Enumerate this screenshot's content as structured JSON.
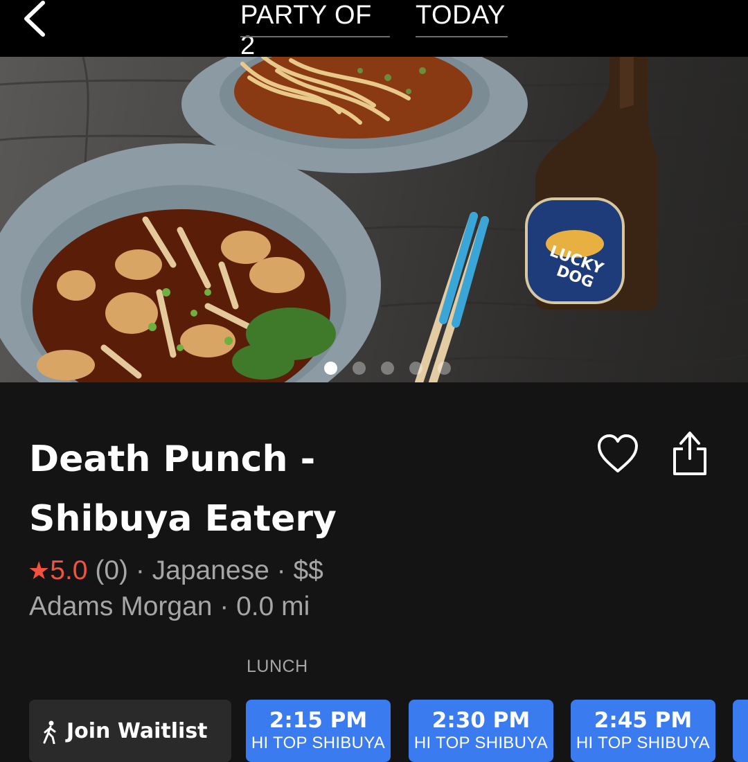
{
  "header": {
    "party_label": "PARTY OF 2",
    "date_label": "TODAY",
    "back_icon": "chevron-left-icon"
  },
  "hero": {
    "carousel_count": 5,
    "active_index": 0
  },
  "restaurant": {
    "name": "Death Punch - Shibuya Eatery",
    "name_line1": "Death Punch -",
    "name_line2": "Shibuya Eatery",
    "star": "★",
    "rating": "5.0",
    "meta_rest": " (0) · Japanese · $$",
    "location_line": "Adams Morgan · 0.0 mi",
    "favorite_icon": "heart-icon",
    "share_icon": "share-icon"
  },
  "booking": {
    "section_label": "LUNCH",
    "waitlist_label": "Join Waitlist",
    "slots": [
      {
        "time": "2:15 PM",
        "seating": "HI TOP SHIBUYA"
      },
      {
        "time": "2:30 PM",
        "seating": "HI TOP SHIBUYA"
      },
      {
        "time": "2:45 PM",
        "seating": "HI TOP SHIBUYA"
      }
    ]
  },
  "colors": {
    "accent_blue": "#3a7bf0",
    "rating_red": "#f5513d",
    "background": "#141414"
  }
}
